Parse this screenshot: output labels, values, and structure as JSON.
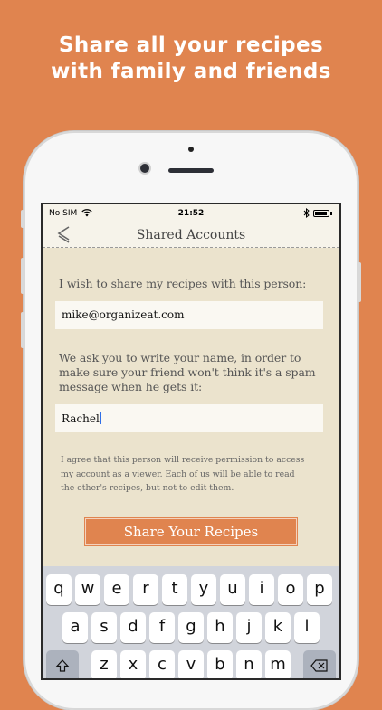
{
  "promo": {
    "line1": "Share all your recipes",
    "line2": "with family and friends"
  },
  "status_bar": {
    "carrier": "No SIM",
    "time": "21:52",
    "icons": [
      "wifi-icon",
      "bluetooth-icon",
      "battery-icon"
    ]
  },
  "nav": {
    "title": "Shared Accounts",
    "back_icon": "chevron-left-icon"
  },
  "form": {
    "email_label": "I wish to share my recipes with this person:",
    "email_value": "mike@organizeat.com",
    "name_label_lines": [
      "We ask you to write your name, in order to",
      "make sure your friend won't think it's a spam",
      "message when he gets it:"
    ],
    "name_value": "Rachel",
    "agreement_lines": [
      "I agree that this person will receive permission to access",
      "my account as a viewer. Each of us will be able to read",
      "the other's recipes, but not to edit them."
    ],
    "share_button": "Share Your Recipes"
  },
  "keyboard": {
    "row1": [
      "q",
      "w",
      "e",
      "r",
      "t",
      "y",
      "u",
      "i",
      "o",
      "p"
    ],
    "row2": [
      "a",
      "s",
      "d",
      "f",
      "g",
      "h",
      "j",
      "k",
      "l"
    ],
    "row3": [
      "z",
      "x",
      "c",
      "v",
      "b",
      "n",
      "m"
    ],
    "shift_icon": "shift-icon",
    "delete_icon": "backspace-icon"
  },
  "colors": {
    "background": "#e0844f",
    "accent": "#e0844f",
    "screen_bg": "#ebe3cd",
    "field_bg": "#faf8f2"
  }
}
